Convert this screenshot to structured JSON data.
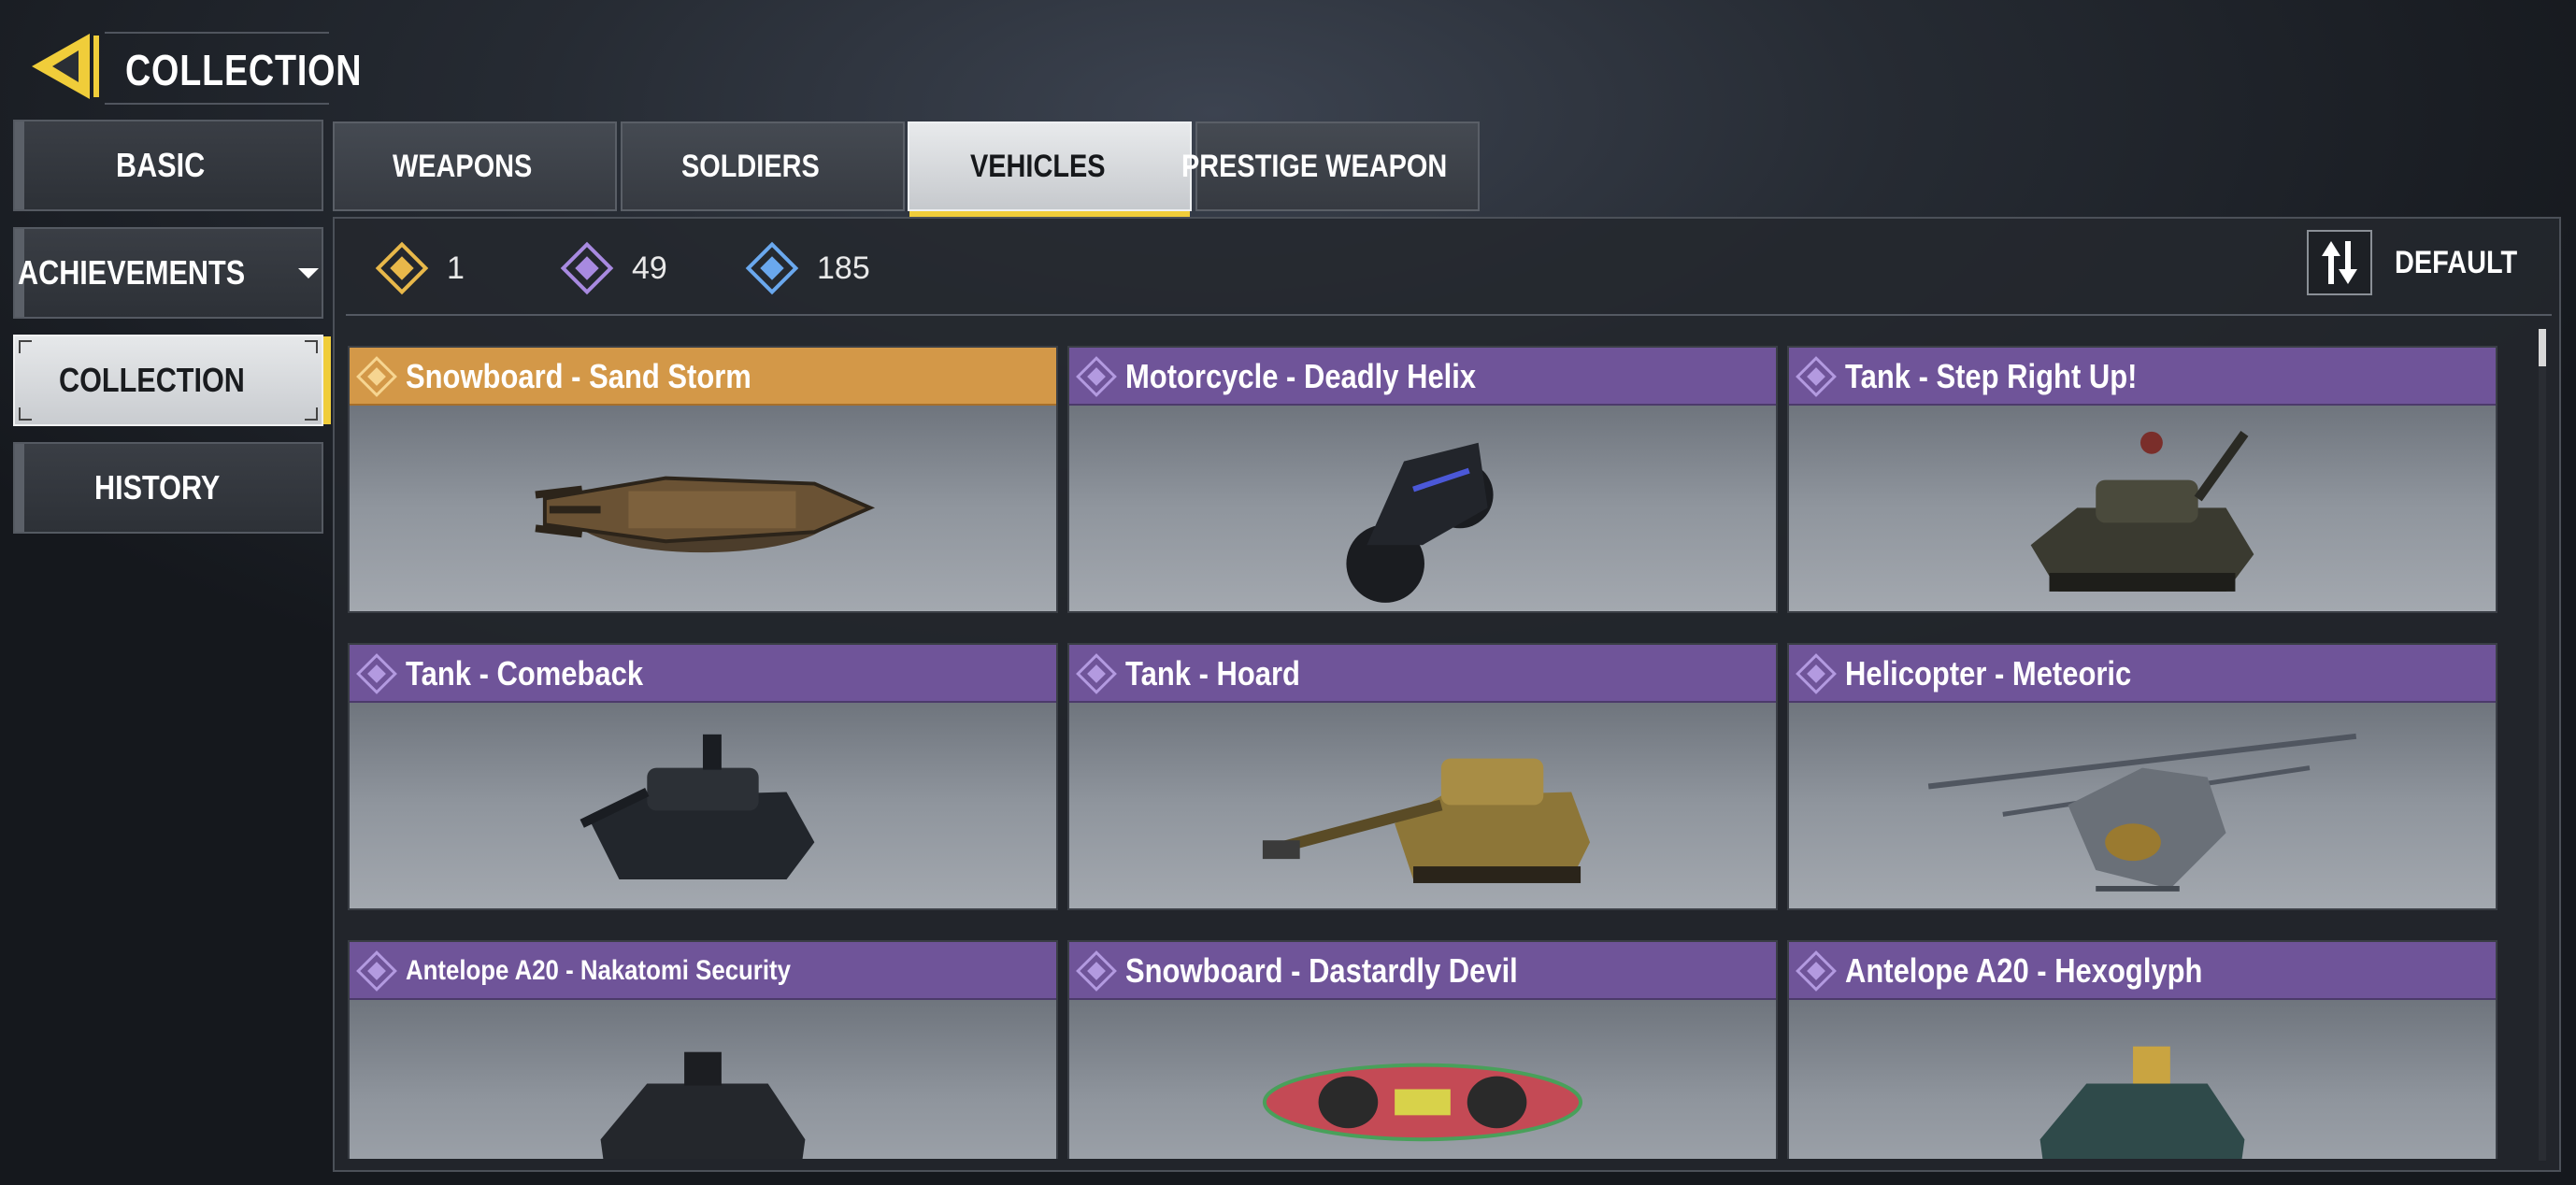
{
  "header": {
    "title": "COLLECTION",
    "back_icon": "back-arrow-icon",
    "accent": "#f0cd3a"
  },
  "sidebar": {
    "items": [
      {
        "label": "BASIC"
      },
      {
        "label": "ACHIEVEMENTS"
      },
      {
        "label": "COLLECTION",
        "active": true
      },
      {
        "label": "HISTORY"
      }
    ]
  },
  "tabs": [
    {
      "label": "WEAPONS"
    },
    {
      "label": "SOLDIERS"
    },
    {
      "label": "VEHICLES",
      "active": true
    },
    {
      "label": "PRESTIGE WEAPON"
    }
  ],
  "counters": [
    {
      "value": "1",
      "icon": "legendary-diamond-icon",
      "color": "#e8b84a"
    },
    {
      "value": "49",
      "icon": "epic-diamond-icon",
      "color": "#a88ae0"
    },
    {
      "value": "185",
      "icon": "rare-diamond-icon",
      "color": "#6aa8ee"
    }
  ],
  "sort": {
    "label": "DEFAULT",
    "icon": "sort-icon"
  },
  "rarity_colors": {
    "legendary": "#d39848",
    "epic": "#6f5499"
  },
  "items": [
    {
      "name": "Snowboard - Sand Storm",
      "rarity": "legendary"
    },
    {
      "name": "Motorcycle - Deadly Helix",
      "rarity": "epic"
    },
    {
      "name": "Tank - Step Right Up!",
      "rarity": "epic"
    },
    {
      "name": "Tank - Comeback",
      "rarity": "epic"
    },
    {
      "name": "Tank - Hoard",
      "rarity": "epic"
    },
    {
      "name": "Helicopter - Meteoric",
      "rarity": "epic"
    },
    {
      "name": "Antelope A20 - Nakatomi Security",
      "rarity": "epic"
    },
    {
      "name": "Snowboard - Dastardly Devil",
      "rarity": "epic"
    },
    {
      "name": "Antelope A20 - Hexoglyph",
      "rarity": "epic"
    }
  ]
}
